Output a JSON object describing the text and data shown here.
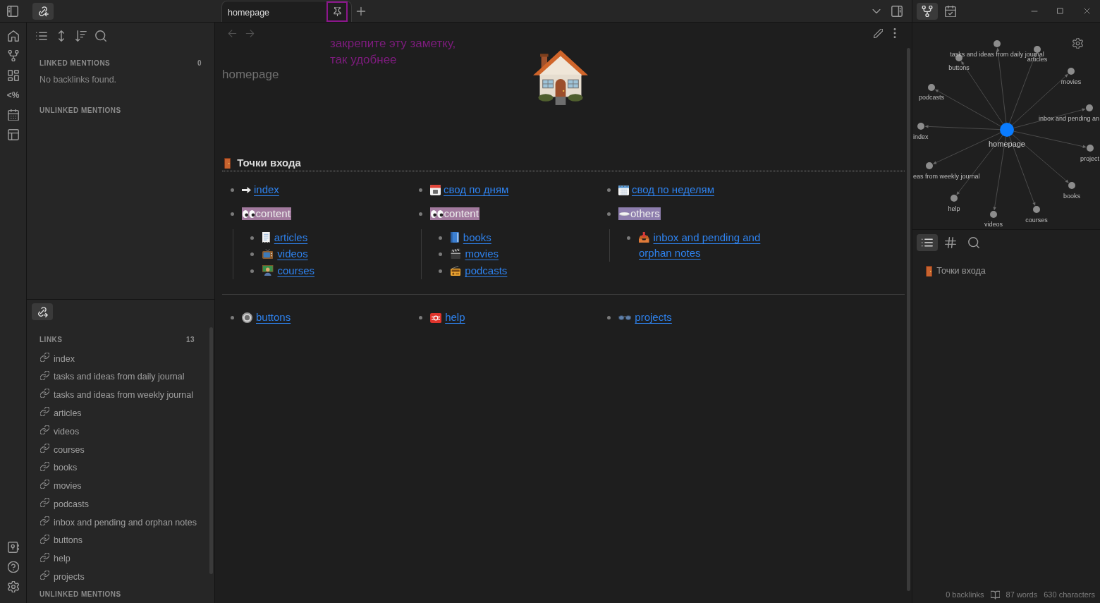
{
  "ribbon": {
    "glyph_button": "<%"
  },
  "left_sidebar": {
    "top_tabs": [
      {
        "kind": "backlinks",
        "selected": true
      }
    ],
    "backlinks": {
      "linked_heading": "LINKED MENTIONS",
      "linked_count": "0",
      "empty_message": "No backlinks found.",
      "unlinked_heading": "UNLINKED MENTIONS"
    },
    "bottom_tabs": [
      {
        "kind": "outgoing_links",
        "selected": true
      }
    ],
    "outgoing_links": {
      "heading": "LINKS",
      "count": "13",
      "items": [
        "index",
        "tasks and ideas from daily journal",
        "tasks and ideas from weekly journal",
        "articles",
        "videos",
        "courses",
        "books",
        "movies",
        "podcasts",
        "inbox and pending and orphan notes",
        "buttons",
        "help",
        "projects"
      ],
      "unlinked_heading": "UNLINKED MENTIONS"
    }
  },
  "tabs": [
    {
      "label": "homepage",
      "selected": true
    }
  ],
  "annotation": {
    "text": "закрепите эту заметку,\nтак удобнее",
    "frames_pin_button": true
  },
  "navigation": {
    "back_disabled": true,
    "forward_disabled": true
  },
  "note": {
    "title": "homepage",
    "heading": "Точки входа",
    "columns": [
      {
        "items": [
          {
            "kind": "link",
            "text": "index"
          },
          {
            "kind": "highlight",
            "text": "content",
            "color": "#a27a9e",
            "children": [
              "articles",
              "videos",
              "courses"
            ]
          }
        ]
      },
      {
        "items": [
          {
            "kind": "link",
            "text": "свод по дням"
          },
          {
            "kind": "highlight",
            "text": "content",
            "color": "#a27a9e",
            "children": [
              "books",
              "movies",
              "podcasts"
            ]
          }
        ]
      },
      {
        "items": [
          {
            "kind": "link",
            "text": "свод по неделям"
          },
          {
            "kind": "highlight",
            "text": "others",
            "color": "#8e7eae",
            "children": [
              "inbox and pending and orphan notes"
            ]
          }
        ]
      }
    ],
    "footer_links": [
      "buttons",
      "help",
      "projects"
    ]
  },
  "right_sidebar": {
    "tabs": [
      {
        "kind": "graph",
        "selected": true
      },
      {
        "kind": "calendar",
        "selected": false
      }
    ],
    "graph": {
      "center": "homepage",
      "nodes": [
        "tasks and ideas from daily journal",
        "buttons",
        "articles",
        "movies",
        "podcasts",
        "inbox and pending an",
        "index",
        "project",
        "eas from weekly journal",
        "books",
        "help",
        "courses",
        "videos"
      ]
    },
    "outline": {
      "tabs": [
        {
          "kind": "outline",
          "selected": true
        },
        {
          "kind": "tags",
          "selected": false
        },
        {
          "kind": "search",
          "selected": false
        }
      ],
      "items": [
        "Точки входа"
      ]
    },
    "status_bar": {
      "backlinks": "0 backlinks",
      "words": "87 words",
      "characters": "630 characters"
    }
  }
}
